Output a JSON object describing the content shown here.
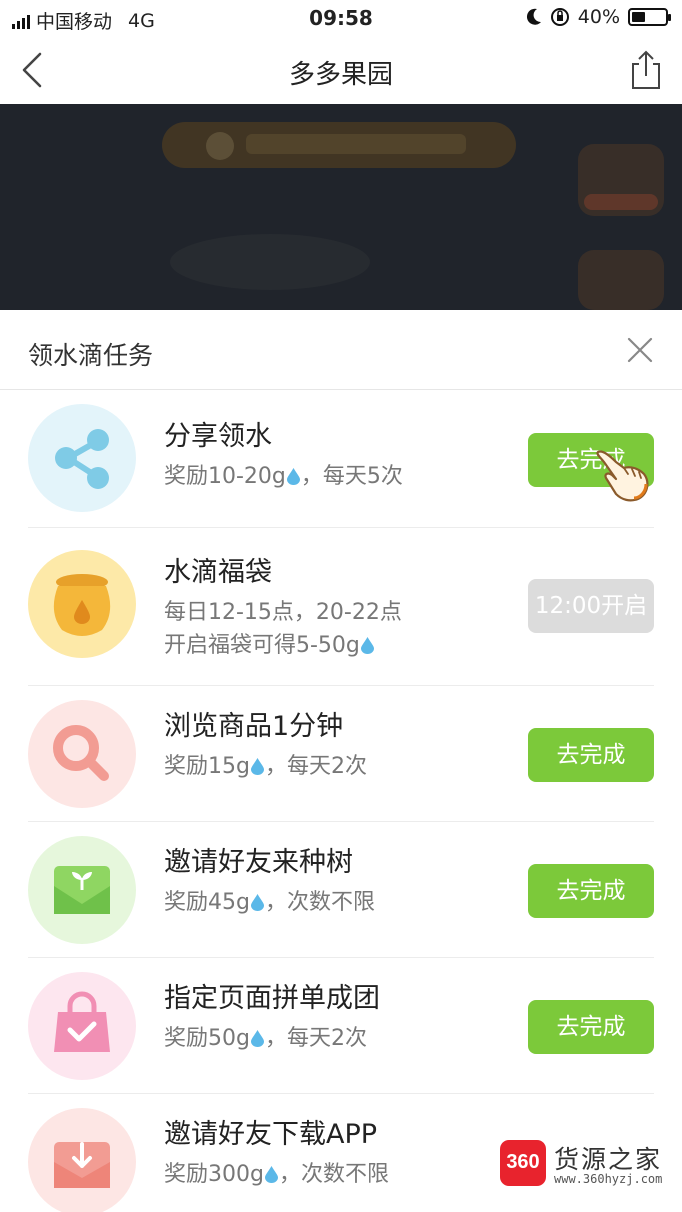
{
  "status_bar": {
    "carrier": "中国移动",
    "network": "4G",
    "time": "09:58",
    "battery": "40%",
    "battery_level": 0.4
  },
  "nav": {
    "title": "多多果园",
    "back_icon": "chevron-left-icon",
    "share_icon": "share-icon"
  },
  "panel": {
    "title": "领水滴任务",
    "close_icon": "close-icon",
    "tasks": [
      {
        "title": "分享领水",
        "desc_prefix": "奖励10-20g",
        "desc_suffix": "，每天5次",
        "button": "去完成",
        "icon": "share-icon",
        "icon_bg": "#e3f4fa",
        "icon_color": "#7fcbe6"
      },
      {
        "title": "水滴福袋",
        "desc_line1": "每日12-15点，20-22点",
        "desc_prefix": "开启福袋可得5-50g",
        "desc_suffix": "",
        "button": "12:00开启",
        "icon": "lucky-bag-icon",
        "icon_bg": "#fde9a8",
        "icon_color": "#f4b73a"
      },
      {
        "title": "浏览商品1分钟",
        "desc_prefix": "奖励15g",
        "desc_suffix": "，每天2次",
        "button": "去完成",
        "icon": "search-icon",
        "icon_bg": "#fde6e4",
        "icon_color": "#f29c93"
      },
      {
        "title": "邀请好友来种树",
        "desc_prefix": "奖励45g",
        "desc_suffix": "，次数不限",
        "button": "去完成",
        "icon": "sprout-envelope-icon",
        "icon_bg": "#e6f7dc",
        "icon_color": "#7fcd57"
      },
      {
        "title": "指定页面拼单成团",
        "desc_prefix": "奖励50g",
        "desc_suffix": "，每天2次",
        "button": "去完成",
        "icon": "shopping-bag-icon",
        "icon_bg": "#fde6ef",
        "icon_color": "#f18fb4"
      },
      {
        "title": "邀请好友下载APP",
        "desc_prefix": "奖励300g",
        "desc_suffix": "，次数不限",
        "icon": "download-envelope-icon",
        "icon_bg": "#fde6e4",
        "icon_color": "#f29c93"
      }
    ]
  },
  "watermark": {
    "logo": "360",
    "name": "货源之家",
    "url": "www.360hyzj.com"
  },
  "colors": {
    "accent_green": "#7cc93a",
    "disabled_gray": "#dcdcdc",
    "drop_blue": "#5bb8e8"
  }
}
